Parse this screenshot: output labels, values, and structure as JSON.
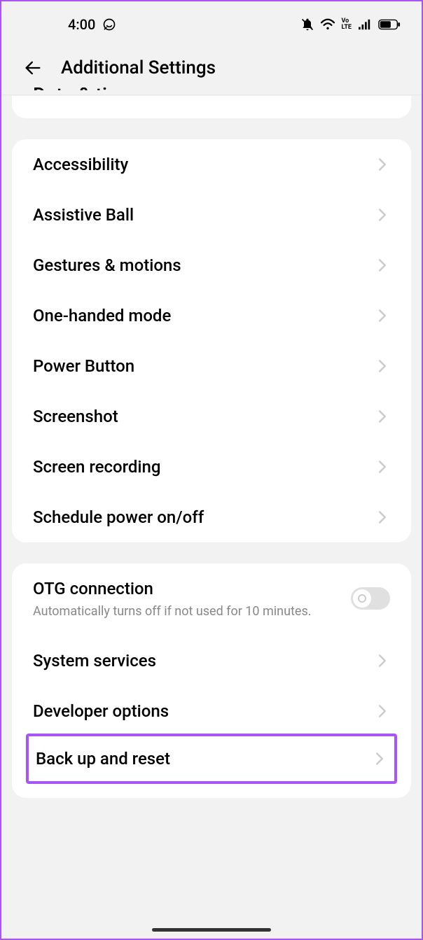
{
  "status_bar": {
    "time": "4:00"
  },
  "header": {
    "title": "Additional Settings"
  },
  "card_partial": {
    "label": "Date & time"
  },
  "card1": {
    "items": [
      {
        "label": "Accessibility"
      },
      {
        "label": "Assistive Ball"
      },
      {
        "label": "Gestures & motions"
      },
      {
        "label": "One-handed mode"
      },
      {
        "label": "Power Button"
      },
      {
        "label": "Screenshot"
      },
      {
        "label": "Screen recording"
      },
      {
        "label": "Schedule power on/off"
      }
    ]
  },
  "card2": {
    "otg": {
      "title": "OTG connection",
      "subtitle": "Automatically turns off if not used for 10 minutes."
    },
    "items": [
      {
        "label": "System services"
      },
      {
        "label": "Developer options"
      },
      {
        "label": "Back up and reset"
      }
    ]
  }
}
